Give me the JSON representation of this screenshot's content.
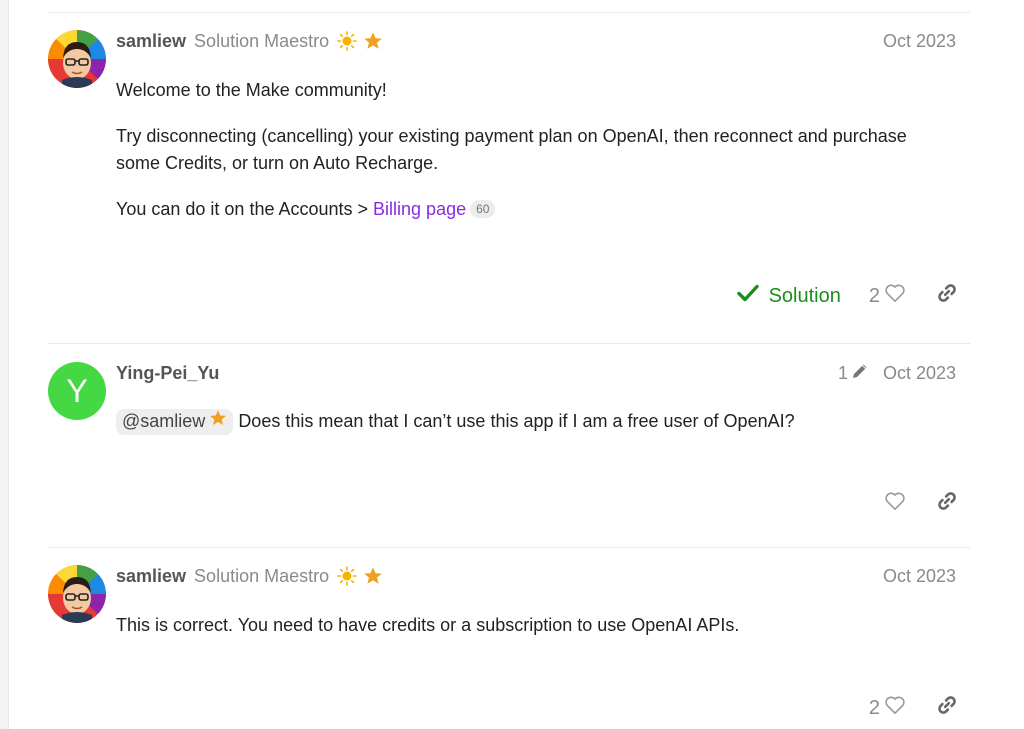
{
  "posts": [
    {
      "username": "samliew",
      "user_title": "Solution Maestro",
      "date": "Oct 2023",
      "paragraphs": [
        "Welcome to the Make community!",
        "Try disconnecting (cancelling) your existing payment plan on OpenAI, then reconnect and purchase some Credits, or turn on Auto Recharge."
      ],
      "link_prefix": "You can do it on the Accounts > ",
      "link_text": "Billing page",
      "link_clicks": "60",
      "solution_label": "Solution",
      "likes": "2"
    },
    {
      "username": "Ying-Pei_Yu",
      "avatar_letter": "Y",
      "edit_count": "1",
      "date": "Oct 2023",
      "mention": "@samliew",
      "text": "Does this mean that I can’t use this app if I am a free user of OpenAI?",
      "likes": ""
    },
    {
      "username": "samliew",
      "user_title": "Solution Maestro",
      "date": "Oct 2023",
      "text": "This is correct. You need to have credits or a subscription to use OpenAI APIs.",
      "likes": "2"
    }
  ],
  "icons": {
    "flair": "sun-icon",
    "badge": "star-icon",
    "solution": "check-icon",
    "like": "heart-icon",
    "share": "link-icon",
    "edit": "pencil-icon"
  },
  "colors": {
    "link": "#8a2be2",
    "solution": "#1a8f1a",
    "star": "#f0a020",
    "avatar_y": "#45d845"
  }
}
